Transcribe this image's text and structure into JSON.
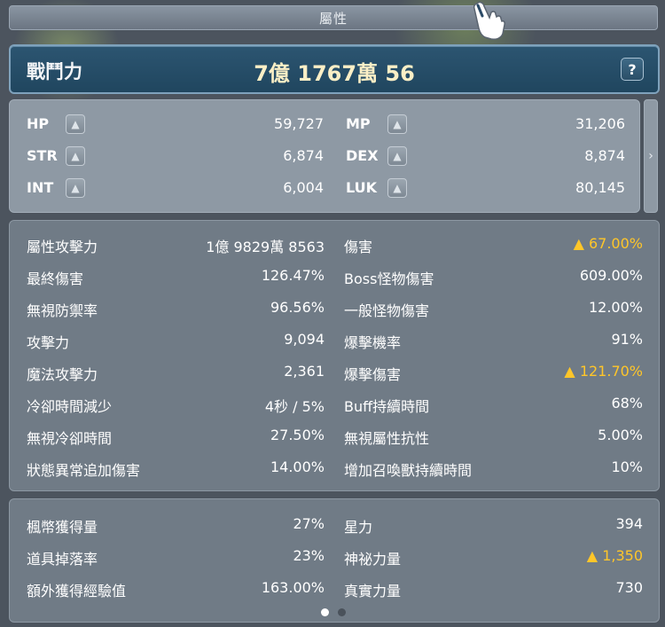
{
  "window": {
    "title": "屬性"
  },
  "combat_power": {
    "label": "戰鬥力",
    "value": "7億 1767萬 56",
    "help": "?"
  },
  "base_stats": {
    "left": [
      {
        "label": "HP",
        "value": "59,727"
      },
      {
        "label": "STR",
        "value": "6,874"
      },
      {
        "label": "INT",
        "value": "6,004"
      }
    ],
    "right": [
      {
        "label": "MP",
        "value": "31,206"
      },
      {
        "label": "DEX",
        "value": "8,874"
      },
      {
        "label": "LUK",
        "value": "80,145"
      }
    ],
    "plus_icon": "▲",
    "expand_icon": "›"
  },
  "detail_stats": {
    "left": [
      {
        "label": "屬性攻擊力",
        "value": "1億 9829萬 8563"
      },
      {
        "label": "最終傷害",
        "value": "126.47%"
      },
      {
        "label": "無視防禦率",
        "value": "96.56%"
      },
      {
        "label": "攻擊力",
        "value": "9,094"
      },
      {
        "label": "魔法攻擊力",
        "value": "2,361"
      },
      {
        "label": "冷卻時間減少",
        "value": "4秒 / 5%"
      },
      {
        "label": "無視冷卻時間",
        "value": "27.50%"
      },
      {
        "label": "狀態異常追加傷害",
        "value": "14.00%"
      }
    ],
    "right": [
      {
        "label": "傷害",
        "value": "▲ 67.00%",
        "highlight": true
      },
      {
        "label": "Boss怪物傷害",
        "value": "609.00%"
      },
      {
        "label": "一般怪物傷害",
        "value": "12.00%"
      },
      {
        "label": "爆擊機率",
        "value": "91%"
      },
      {
        "label": "爆擊傷害",
        "value": "▲ 121.70%",
        "highlight": true
      },
      {
        "label": "Buff持續時間",
        "value": "68%"
      },
      {
        "label": "無視屬性抗性",
        "value": "5.00%"
      },
      {
        "label": "增加召喚獸持續時間",
        "value": "10%"
      }
    ]
  },
  "extra_stats": {
    "left": [
      {
        "label": "楓幣獲得量",
        "value": "27%"
      },
      {
        "label": "道具掉落率",
        "value": "23%"
      },
      {
        "label": "額外獲得經驗值",
        "value": "163.00%"
      }
    ],
    "right": [
      {
        "label": "星力",
        "value": "394"
      },
      {
        "label": "神祕力量",
        "value": "▲ 1,350",
        "highlight": true
      },
      {
        "label": "真實力量",
        "value": "730"
      }
    ]
  },
  "colors": {
    "highlight": "#ffc629",
    "cp_value": "#fbefc6"
  },
  "pagination": {
    "pages": 2,
    "current": 1
  }
}
